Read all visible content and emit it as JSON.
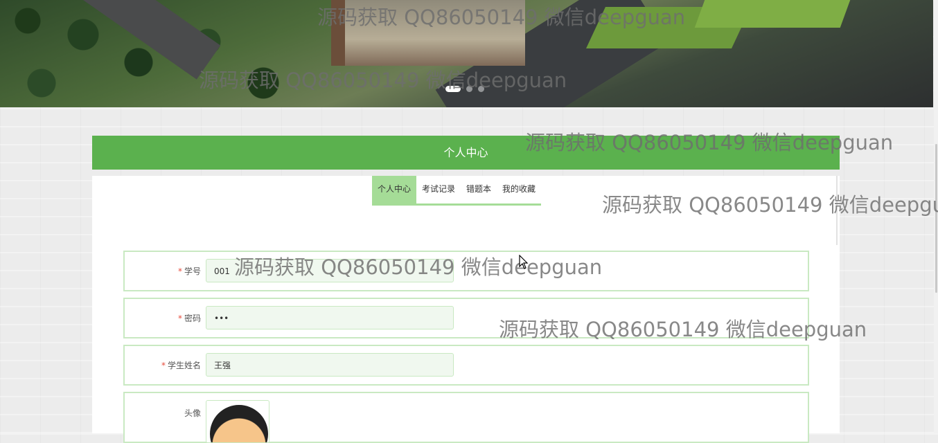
{
  "banner": {
    "slides_total": 3,
    "active_slide": 1
  },
  "page_title": "个人中心",
  "tabs": [
    {
      "label": "个人中心",
      "active": true
    },
    {
      "label": "考试记录",
      "active": false
    },
    {
      "label": "错题本",
      "active": false
    },
    {
      "label": "我的收藏",
      "active": false
    }
  ],
  "form": {
    "required_mark": "*",
    "student_id": {
      "label": "学号",
      "value": "001",
      "required": true
    },
    "password": {
      "label": "密码",
      "value": "•••",
      "required": true
    },
    "student_name": {
      "label": "学生姓名",
      "value": "王强",
      "required": true
    },
    "avatar": {
      "label": "头像",
      "required": false
    }
  },
  "watermark_text": "源码获取 QQ86050149 微信deepguan",
  "colors": {
    "header_green": "#5bb14e",
    "tab_active": "#a5dc97",
    "row_border": "#c9e9c2",
    "input_bg": "#f0f8ef",
    "required": "#e74c3c"
  }
}
